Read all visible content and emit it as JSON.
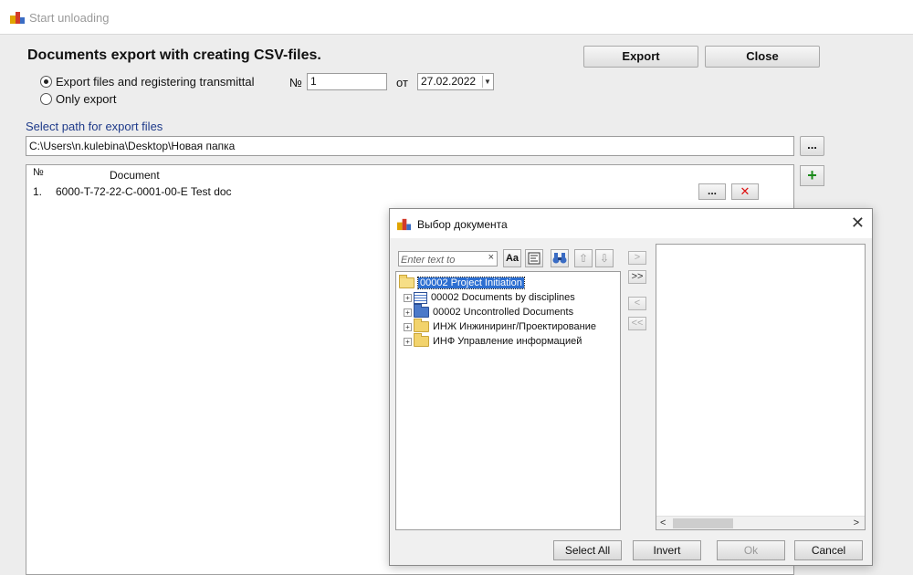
{
  "window": {
    "title": "Start unloading"
  },
  "main": {
    "heading": "Documents export with creating CSV-files.",
    "export_label": "Export",
    "close_label": "Close",
    "radio_options": [
      {
        "label": "Export files and registering transmittal",
        "checked": true
      },
      {
        "label": "Only export",
        "checked": false
      }
    ],
    "number_label": "№",
    "number_value": "1",
    "date_label": "от",
    "date_value": "27.02.2022",
    "path_label": "Select path for export files",
    "path_value": "C:\\Users\\n.kulebina\\Desktop\\Новая папка",
    "browse_label": "...",
    "add_icon": "+",
    "list": {
      "col_num": "№",
      "col_doc": "Document",
      "rows": [
        {
          "num": "1.",
          "doc": "6000-T-72-22-C-0001-00-E Test doc",
          "browse": "...",
          "remove": "✕"
        }
      ]
    }
  },
  "dialog": {
    "title": "Выбор документа",
    "close_icon": "✕",
    "search_placeholder": "Enter text to",
    "search_clear": "×",
    "toolbar": {
      "case_label": "Aa",
      "move_up": "⇧",
      "move_down": "⇩"
    },
    "tree": [
      {
        "label": "00002 Project Initiation",
        "icon": "folder-open-icon",
        "selected": true
      },
      {
        "label": "00002 Documents by disciplines",
        "icon": "document-list-icon",
        "expander": "+"
      },
      {
        "label": "00002 Uncontrolled Documents",
        "icon": "folder-blue-icon",
        "expander": "+"
      },
      {
        "label": "ИНЖ Инжиниринг/Проектирование",
        "icon": "folder-icon",
        "expander": "+"
      },
      {
        "label": "ИНФ Управление информацией",
        "icon": "folder-icon",
        "expander": "+"
      }
    ],
    "transfer": {
      "add_one": ">",
      "add_all": ">>",
      "remove_one": "<",
      "remove_all": "<<"
    },
    "scroll_left": "<",
    "scroll_right": ">",
    "buttons": {
      "select_all": "Select All",
      "invert": "Invert",
      "ok": "Ok",
      "cancel": "Cancel"
    }
  }
}
